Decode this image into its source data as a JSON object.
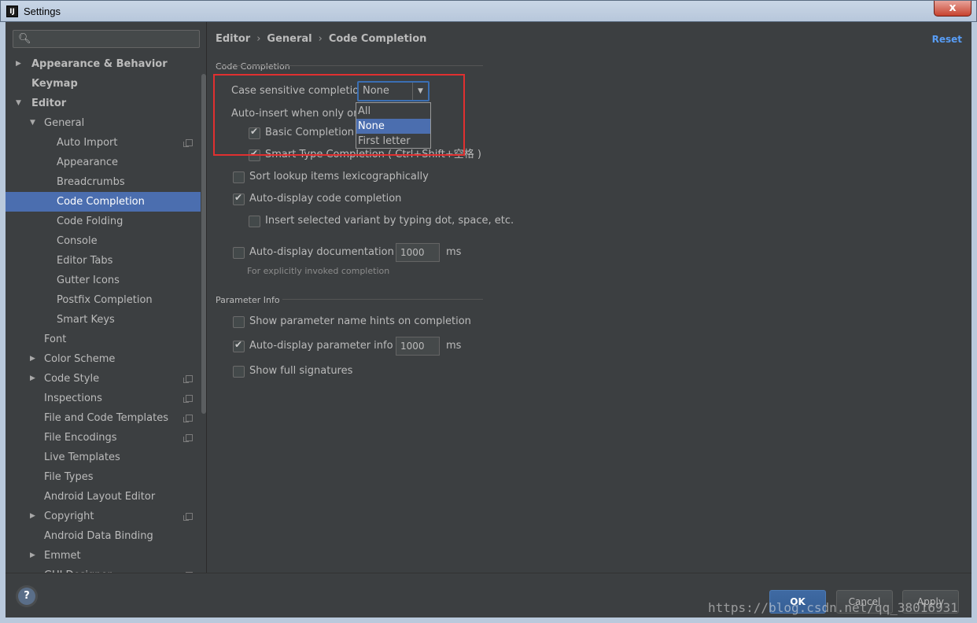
{
  "window": {
    "title": "Settings",
    "app_icon": "IJ",
    "close_glyph": "x"
  },
  "search": {
    "icon": "search-icon",
    "value": ""
  },
  "tree": [
    {
      "label": "Appearance & Behavior",
      "level": 0,
      "bold": true,
      "arrow": "right"
    },
    {
      "label": "Keymap",
      "level": 0,
      "bold": true
    },
    {
      "label": "Editor",
      "level": 0,
      "bold": true,
      "arrow": "down"
    },
    {
      "label": "General",
      "level": 1,
      "arrow": "down"
    },
    {
      "label": "Auto Import",
      "level": 2,
      "copy": true
    },
    {
      "label": "Appearance",
      "level": 2
    },
    {
      "label": "Breadcrumbs",
      "level": 2
    },
    {
      "label": "Code Completion",
      "level": 2,
      "selected": true
    },
    {
      "label": "Code Folding",
      "level": 2
    },
    {
      "label": "Console",
      "level": 2
    },
    {
      "label": "Editor Tabs",
      "level": 2
    },
    {
      "label": "Gutter Icons",
      "level": 2
    },
    {
      "label": "Postfix Completion",
      "level": 2
    },
    {
      "label": "Smart Keys",
      "level": 2
    },
    {
      "label": "Font",
      "level": 1
    },
    {
      "label": "Color Scheme",
      "level": 1,
      "arrow": "right"
    },
    {
      "label": "Code Style",
      "level": 1,
      "arrow": "right",
      "copy": true
    },
    {
      "label": "Inspections",
      "level": 1,
      "copy": true
    },
    {
      "label": "File and Code Templates",
      "level": 1,
      "copy": true
    },
    {
      "label": "File Encodings",
      "level": 1,
      "copy": true
    },
    {
      "label": "Live Templates",
      "level": 1
    },
    {
      "label": "File Types",
      "level": 1
    },
    {
      "label": "Android Layout Editor",
      "level": 1
    },
    {
      "label": "Copyright",
      "level": 1,
      "arrow": "right",
      "copy": true
    },
    {
      "label": "Android Data Binding",
      "level": 1
    },
    {
      "label": "Emmet",
      "level": 1,
      "arrow": "right"
    },
    {
      "label": "GUI Designer",
      "level": 1,
      "copy": true
    }
  ],
  "breadcrumb": {
    "part1": "Editor",
    "part2": "General",
    "part3": "Code Completion",
    "sep": "›"
  },
  "reset_label": "Reset",
  "code_completion": {
    "section_title": "Code Completion",
    "case_label": "Case sensitive completion:",
    "case_value": "None",
    "case_options": [
      "All",
      "None",
      "First letter"
    ],
    "case_selected_index": 1,
    "auto_insert_label": "Auto-insert when only one c",
    "basic_label": "Basic Completion ( (",
    "basic_checked": true,
    "smart_label": "Smart Type Completion ( Ctrl+Shift+空格 )",
    "smart_checked": true,
    "sort_label": "Sort lookup items lexicographically",
    "sort_checked": false,
    "auto_display_label": "Auto-display code completion",
    "auto_display_checked": true,
    "insert_selected_label": "Insert selected variant by typing dot, space, etc.",
    "insert_selected_checked": false,
    "auto_doc_label": "Auto-display documentation in",
    "auto_doc_checked": false,
    "auto_doc_value": "1000",
    "auto_doc_unit": "ms",
    "auto_doc_hint": "For explicitly invoked completion"
  },
  "parameter_info": {
    "section_title": "Parameter Info",
    "hints_label": "Show parameter name hints on completion",
    "hints_checked": false,
    "auto_param_label": "Auto-display parameter info in",
    "auto_param_checked": true,
    "auto_param_value": "1000",
    "auto_param_unit": "ms",
    "full_sig_label": "Show full signatures",
    "full_sig_checked": false
  },
  "buttons": {
    "ok": "OK",
    "cancel": "Cancel",
    "apply": "Apply",
    "help": "?"
  },
  "watermark": "https://blog.csdn.net/qq_38016931",
  "colors": {
    "selection": "#4b6eaf",
    "link": "#589df6",
    "highlight_box": "#e03030",
    "background": "#3c3f41"
  }
}
